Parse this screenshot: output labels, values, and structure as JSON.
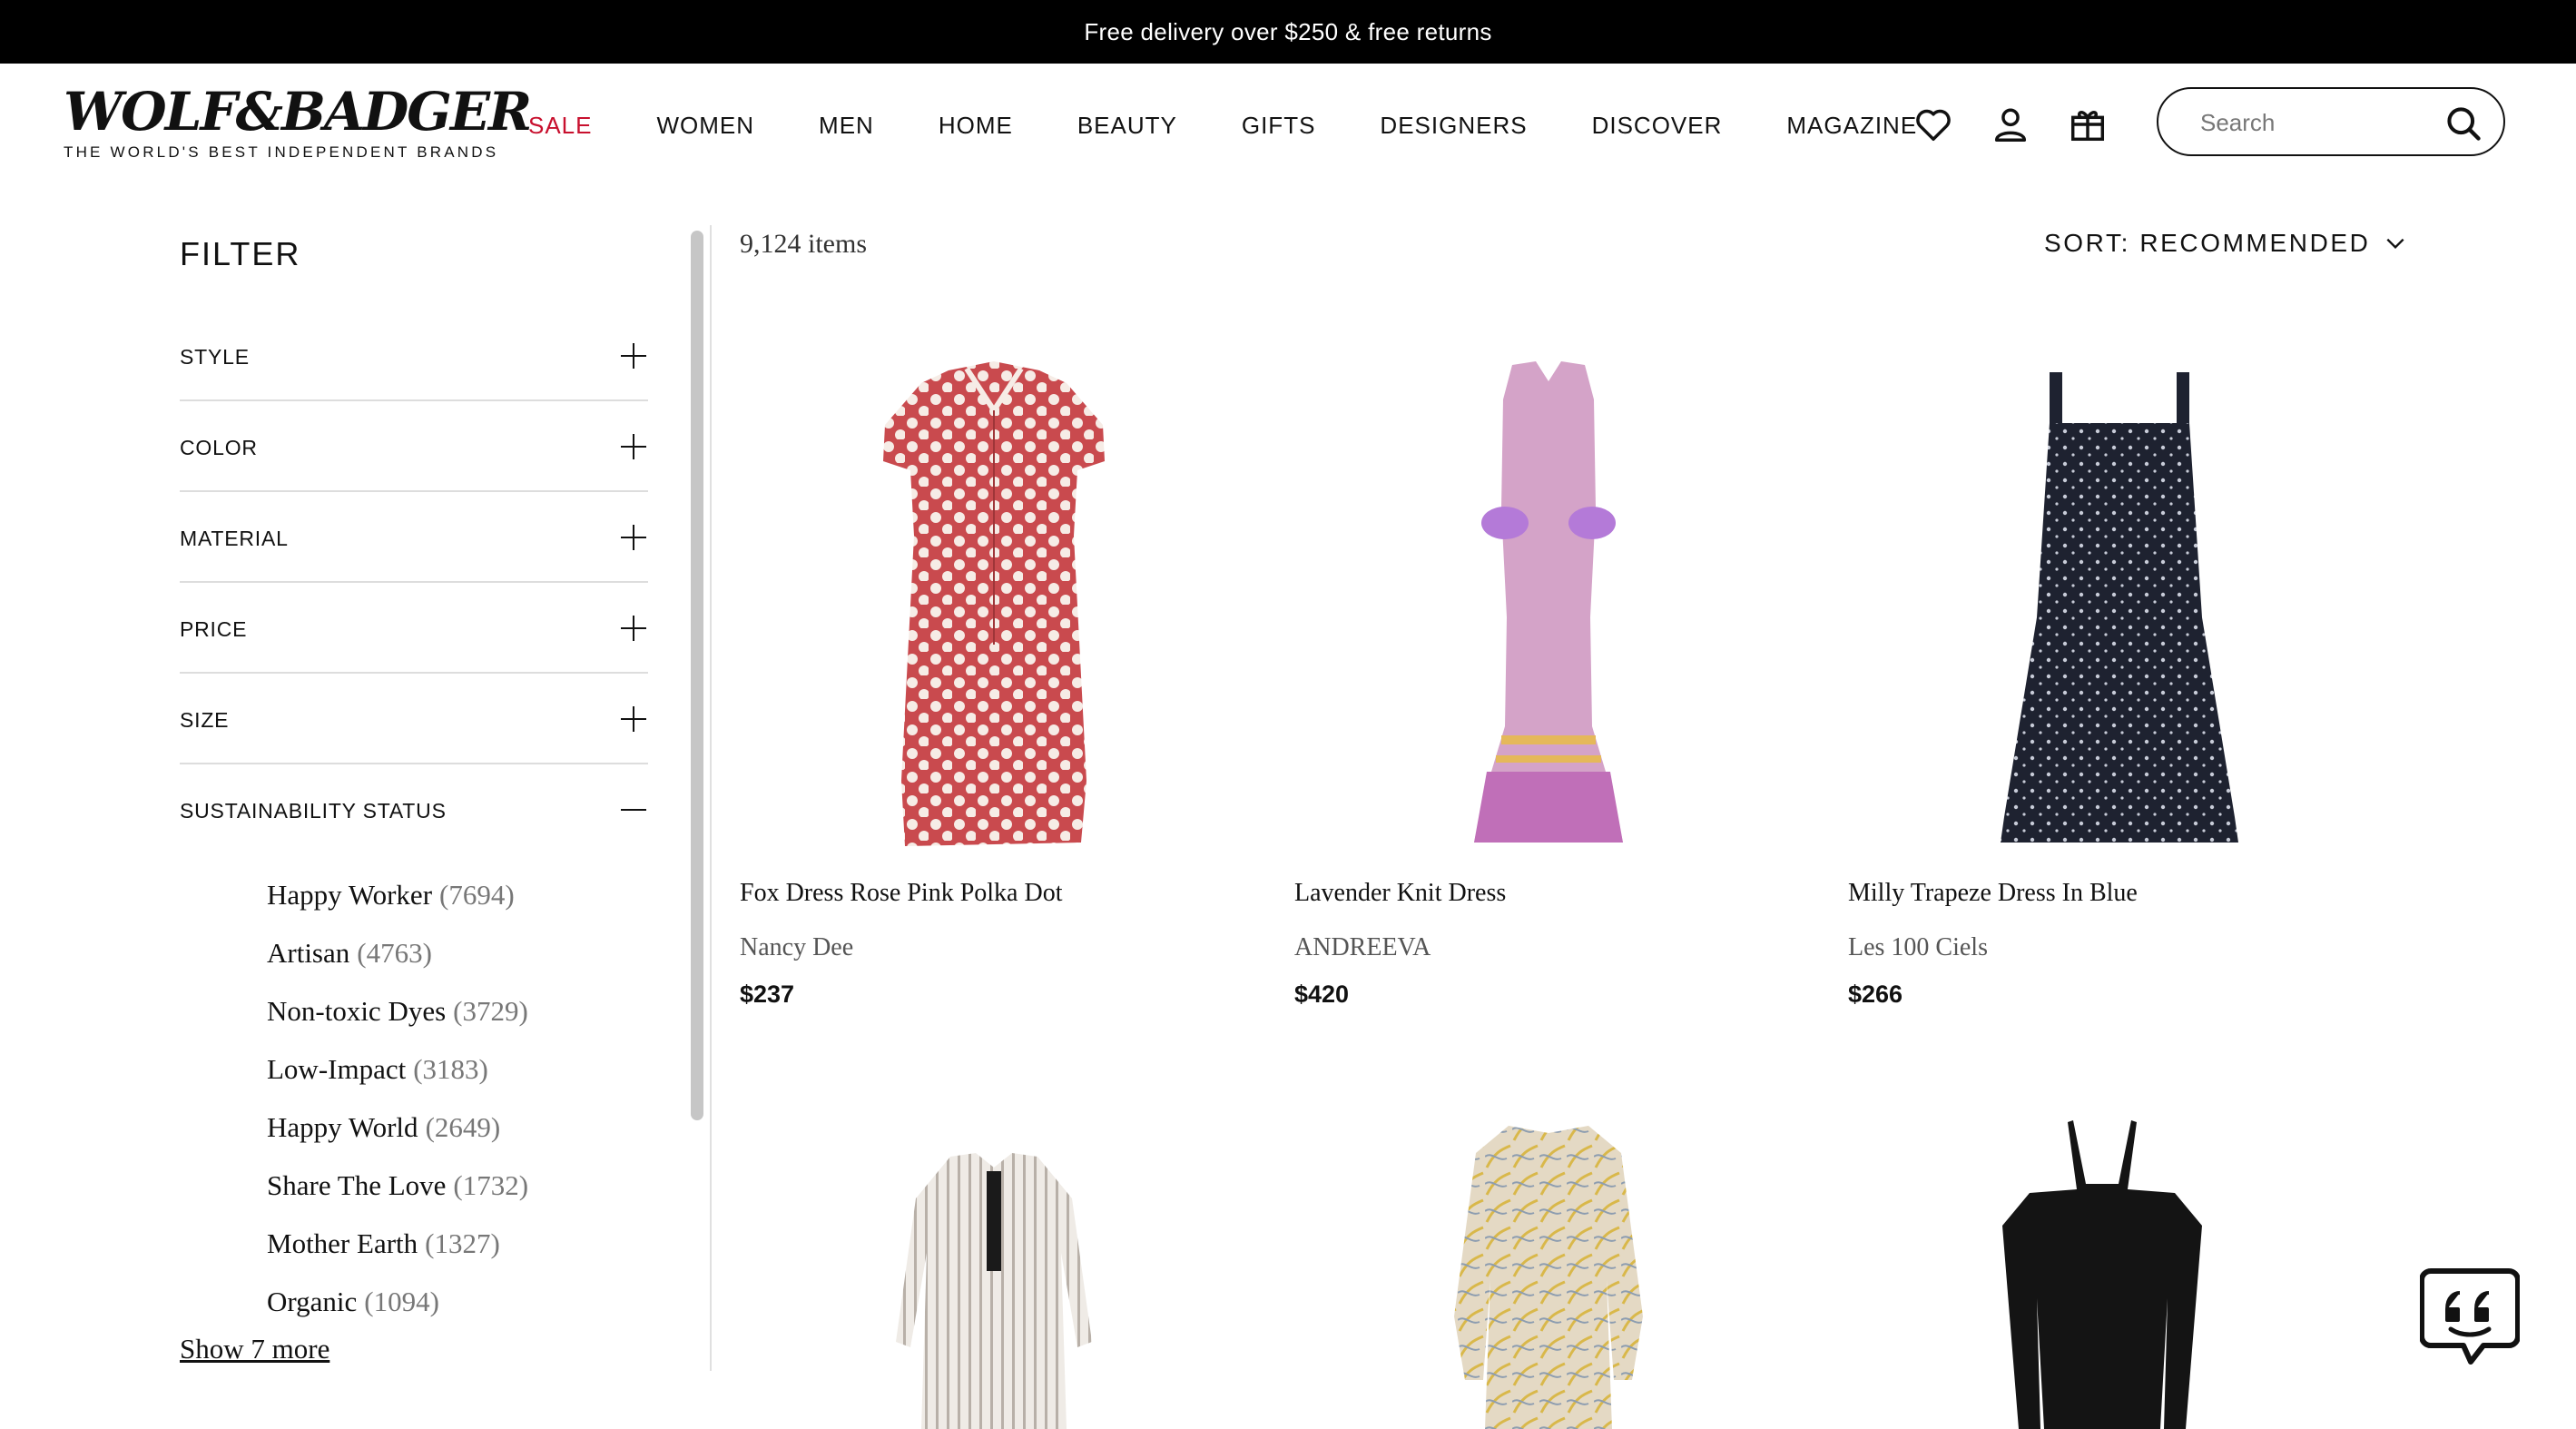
{
  "promo": {
    "text": "Free delivery over $250 & free returns"
  },
  "header": {
    "logo_word": "WOLF&BADGER",
    "logo_tagline": "THE WORLD'S BEST INDEPENDENT BRANDS",
    "nav": [
      "SALE",
      "WOMEN",
      "MEN",
      "HOME",
      "BEAUTY",
      "GIFTS",
      "DESIGNERS",
      "DISCOVER",
      "MAGAZINE"
    ],
    "search_placeholder": "Search",
    "accent_color": "#c8102e"
  },
  "filter": {
    "title": "FILTER",
    "sections": [
      "STYLE",
      "COLOR",
      "MATERIAL",
      "PRICE",
      "SIZE",
      "SUSTAINABILITY STATUS"
    ],
    "sustainability": [
      {
        "label": "Happy Worker",
        "count": "(7694)"
      },
      {
        "label": "Artisan",
        "count": "(4763)"
      },
      {
        "label": "Non-toxic Dyes",
        "count": "(3729)"
      },
      {
        "label": "Low-Impact",
        "count": "(3183)"
      },
      {
        "label": "Happy World",
        "count": "(2649)"
      },
      {
        "label": "Share The Love",
        "count": "(1732)"
      },
      {
        "label": "Mother Earth",
        "count": "(1327)"
      },
      {
        "label": "Organic",
        "count": "(1094)"
      }
    ],
    "show_more": "Show 7 more"
  },
  "listing": {
    "count": "9,124 items",
    "sort_label": "SORT: RECOMMENDED",
    "products": [
      {
        "name": "Fox Dress Rose Pink Polka Dot",
        "brand": "Nancy Dee",
        "price": "$237"
      },
      {
        "name": "Lavender Knit Dress",
        "brand": "ANDREEVA",
        "price": "$420"
      },
      {
        "name": "Milly Trapeze Dress In Blue",
        "brand": "Les 100 Ciels",
        "price": "$266"
      }
    ]
  },
  "icons": [
    "heart-icon",
    "account-icon",
    "gift-bag-icon",
    "search-icon",
    "plus-icon",
    "minus-icon",
    "chevron-down-icon",
    "chat-icon"
  ]
}
